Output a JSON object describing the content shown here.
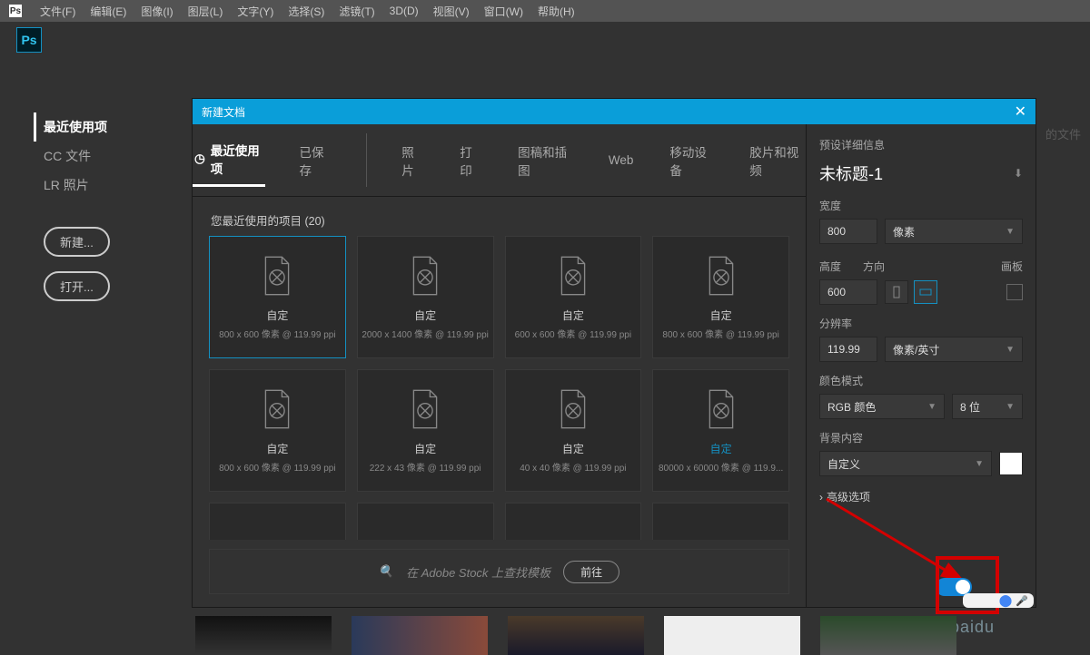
{
  "menu": {
    "items": [
      "文件(F)",
      "编辑(E)",
      "图像(I)",
      "图层(L)",
      "文字(Y)",
      "选择(S)",
      "滤镜(T)",
      "3D(D)",
      "视图(V)",
      "窗口(W)",
      "帮助(H)"
    ]
  },
  "start": {
    "recent": "最近使用项",
    "cc": "CC 文件",
    "lr": "LR 照片",
    "new": "新建...",
    "open": "打开..."
  },
  "faded_behind": "的文件",
  "dialog": {
    "title": "新建文档",
    "tabs": [
      "最近使用项",
      "已保存",
      "照片",
      "打印",
      "图稿和插图",
      "Web",
      "移动设备",
      "胶片和视频"
    ],
    "recent_header": "您最近使用的项目  (20)",
    "presets": [
      {
        "t": "自定",
        "m": "800 x 600 像素 @ 119.99 ppi"
      },
      {
        "t": "自定",
        "m": "2000 x 1400 像素 @ 119.99 ppi"
      },
      {
        "t": "自定",
        "m": "600 x 600 像素 @ 119.99 ppi"
      },
      {
        "t": "自定",
        "m": "800 x 600 像素 @ 119.99 ppi"
      },
      {
        "t": "自定",
        "m": "800 x 600 像素 @ 119.99 ppi"
      },
      {
        "t": "自定",
        "m": "222 x 43 像素 @ 119.99 ppi"
      },
      {
        "t": "自定",
        "m": "40 x 40 像素 @ 119.99 ppi"
      },
      {
        "t": "自定",
        "m": "80000 x 60000 像素 @ 119.9..."
      },
      {
        "t": "",
        "m": ""
      },
      {
        "t": "",
        "m": ""
      },
      {
        "t": "",
        "m": ""
      },
      {
        "t": "",
        "m": ""
      }
    ],
    "stock_placeholder": "在 Adobe Stock 上查找模板",
    "stock_go": "前往"
  },
  "details": {
    "header": "预设详细信息",
    "docname": "未标题-1",
    "width_lbl": "宽度",
    "width": "800",
    "width_unit": "像素",
    "height_lbl": "高度",
    "height": "600",
    "orient_lbl": "方向",
    "artboard_lbl": "画板",
    "res_lbl": "分辨率",
    "res": "119.99",
    "res_unit": "像素/英寸",
    "mode_lbl": "颜色模式",
    "mode": "RGB 颜色",
    "depth": "8 位",
    "bg_lbl": "背景内容",
    "bg": "自定义",
    "adv": "高级选项"
  },
  "watermark": "an.baidu"
}
